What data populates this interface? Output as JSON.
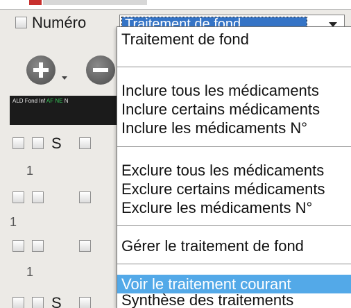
{
  "header": {
    "numero_label": "Numéro",
    "combo_value": "Traitement de fond"
  },
  "toolbar": {
    "ald_text": "ALD Fond Inf",
    "ald_badge": "AF NE",
    "ald_extra": "N"
  },
  "grid": {
    "col_s": "S",
    "row_numbers": [
      "1",
      "1",
      "1"
    ],
    "row_s": "S"
  },
  "menu": {
    "items": [
      "Traitement de fond",
      "Inclure tous les médicaments",
      "Inclure certains médicaments",
      "Inclure les médicaments N°",
      "Exclure tous les médicaments",
      "Exclure certains médicaments",
      "Exclure les médicaments N°",
      "Gérer le traitement de fond",
      "Voir le traitement courant",
      "Synthèse des traitements"
    ],
    "highlighted_index": 8
  },
  "colors": {
    "highlight": "#53a9e8",
    "combo_selection": "#3574c6"
  }
}
